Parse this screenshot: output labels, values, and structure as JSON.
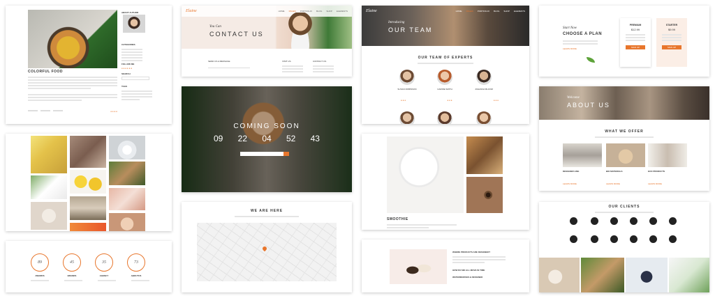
{
  "blog": {
    "logo": "Elaine",
    "post_title": "COLORFUL FOOD",
    "sidebar_about": "ABOUT AUTHOR",
    "sidebar_categories": "CATEGORIES",
    "sidebar_follow": "FOLLOW ME",
    "sidebar_search": "SEARCH",
    "sidebar_tags": "TAGS"
  },
  "contact": {
    "nav_items": [
      "HOME",
      "PAGES",
      "PORTFOLIO",
      "BLOG",
      "SHOP",
      "ELEMENTS"
    ],
    "kicker": "You Can",
    "title": "CONTACT US",
    "col1": "SEND US A MESSAGE",
    "col2": "VISIT US",
    "col3": "CONTACT US"
  },
  "team": {
    "kicker": "Introducing",
    "title": "OUR TEAM",
    "section_title": "OUR TEAM OF EXPERTS",
    "members": [
      "SUSAN ROBINSON",
      "CARRIE SMITH",
      "JOHANNA BLOOM"
    ]
  },
  "plan": {
    "kicker": "Start Now",
    "title": "CHOOSE A PLAN",
    "link": "LEARN MORE",
    "plans": [
      {
        "name": "PREMIUM",
        "price": "$12.99",
        "button": "SIGN UP"
      },
      {
        "name": "STARTER",
        "price": "$9.99",
        "button": "SIGN UP"
      }
    ]
  },
  "coming_soon": {
    "title": "COMING SOON",
    "countdown": [
      "09",
      "22",
      "04",
      "52",
      "43"
    ]
  },
  "about": {
    "kicker": "Welcome",
    "title": "ABOUT US",
    "section_title": "WHAT WE OFFER",
    "offers": [
      "DESIGNER LINE",
      "BIO MATERIALS",
      "ECO PRODUCTS"
    ],
    "link": "LEARN MORE"
  },
  "recipe": {
    "title": "SMOOTHIE"
  },
  "stats": {
    "items": [
      {
        "value": "89",
        "label": "AWARDS"
      },
      {
        "value": "45",
        "label": "BRANDS"
      },
      {
        "value": "35",
        "label": "AGENCY"
      },
      {
        "value": "73",
        "label": "ABOUTUS"
      }
    ]
  },
  "map": {
    "title": "WE ARE HERE"
  },
  "faq": {
    "items": [
      "WHERE PRODUCTS ARE DESIGNED?",
      "HOW DO WE ALL MOVE IN TIME",
      "WATERMARKED & DESIGNED"
    ]
  },
  "clients": {
    "title": "OUR CLIENTS"
  },
  "colors": {
    "accent": "#e8762c"
  }
}
